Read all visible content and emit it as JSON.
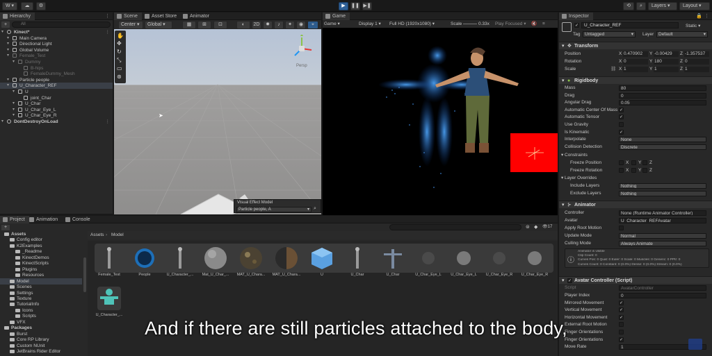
{
  "toolbar": {
    "account_label": "W ▾",
    "layers_label": "Layers",
    "layout_label": "Layout"
  },
  "hierarchy": {
    "tab": "Hierarchy",
    "search_placeholder": "All",
    "items": [
      {
        "label": "Kinect*",
        "indent": 0,
        "state": "scene"
      },
      {
        "label": "Main Camera",
        "indent": 1,
        "state": "normal"
      },
      {
        "label": "Directional Light",
        "indent": 1,
        "state": "normal"
      },
      {
        "label": "Global Volume",
        "indent": 1,
        "state": "normal"
      },
      {
        "label": "Female_Test",
        "indent": 1,
        "state": "dim"
      },
      {
        "label": "Dummy",
        "indent": 2,
        "state": "dim"
      },
      {
        "label": "B-hips",
        "indent": 3,
        "state": "dim"
      },
      {
        "label": "FemaleDummy_Mesh",
        "indent": 3,
        "state": "dim"
      },
      {
        "label": "Particle people",
        "indent": 1,
        "state": "normal"
      },
      {
        "label": "U_Character_REF",
        "indent": 1,
        "state": "selected"
      },
      {
        "label": "U",
        "indent": 2,
        "state": "normal"
      },
      {
        "label": "joint_Char",
        "indent": 3,
        "state": "normal"
      },
      {
        "label": "U_Char",
        "indent": 2,
        "state": "normal"
      },
      {
        "label": "U_Char_Eye_L",
        "indent": 2,
        "state": "normal"
      },
      {
        "label": "U_Char_Eye_R",
        "indent": 2,
        "state": "normal"
      },
      {
        "label": "DontDestroyOnLoad",
        "indent": 0,
        "state": "scene"
      }
    ]
  },
  "scene": {
    "tabs": [
      "Scene",
      "Asset Store",
      "Animator"
    ],
    "pivot": "Center",
    "space": "Global",
    "mode_2d": "2D",
    "persp_label": "Persp",
    "vfx_title": "Visual Effect Model",
    "vfx_value": "Particle people, A"
  },
  "game": {
    "tab": "Game",
    "mode": "Game",
    "display": "Display 1",
    "resolution": "Full HD (1920x1080)",
    "scale_label": "Scale",
    "scale_value": "0.33x",
    "play_focused": "Play Focused"
  },
  "inspector": {
    "tab": "Inspector",
    "object_name": "U_Character_REF",
    "static_label": "Static",
    "tag_label": "Tag",
    "tag_value": "Untagged",
    "layer_label": "Layer",
    "layer_value": "Default",
    "transform": {
      "title": "Transform",
      "position_label": "Position",
      "position": {
        "x": "0.470902",
        "y": "-0.00429",
        "z": "-1.357537"
      },
      "rotation_label": "Rotation",
      "rotation": {
        "x": "0",
        "y": "180",
        "z": "0"
      },
      "scale_label": "Scale",
      "scale": {
        "x": "1",
        "y": "1",
        "z": "1"
      }
    },
    "rigidbody": {
      "title": "Rigidbody",
      "rows": [
        {
          "label": "Mass",
          "value": "80",
          "kind": "field"
        },
        {
          "label": "Drag",
          "value": "0",
          "kind": "field"
        },
        {
          "label": "Angular Drag",
          "value": "0.05",
          "kind": "field"
        },
        {
          "label": "Automatic Center Of Mass",
          "value": "✓",
          "kind": "check"
        },
        {
          "label": "Automatic Tensor",
          "value": "✓",
          "kind": "check"
        },
        {
          "label": "Use Gravity",
          "value": "",
          "kind": "check"
        },
        {
          "label": "Is Kinematic",
          "value": "✓",
          "kind": "check"
        },
        {
          "label": "Interpolate",
          "value": "None",
          "kind": "field"
        },
        {
          "label": "Collision Detection",
          "value": "Discrete",
          "kind": "field"
        }
      ],
      "constraints": "Constraints",
      "freeze_position": "Freeze Position",
      "freeze_rotation": "Freeze Rotation",
      "layer_overrides": "Layer Overrides",
      "include_layers": "Include Layers",
      "include_value": "Nothing",
      "exclude_layers": "Exclude Layers",
      "exclude_value": "Nothing"
    },
    "animator": {
      "title": "Animator",
      "controller_label": "Controller",
      "controller_value": "None (Runtime Animator Controller)",
      "avatar_label": "Avatar",
      "avatar_value": "U_Character_REFAvatar",
      "root_motion_label": "Apply Root Motion",
      "update_mode_label": "Update Mode",
      "update_mode_value": "Normal",
      "culling_mode_label": "Culling Mode",
      "culling_mode_value": "Always Animate",
      "info_lines": [
        "Animator is visible",
        "Clip Count: 0",
        "Curves Pos: 0 Quat: 0 Euler: 0 Scale: 0 Muscles: 0 Generic: 0 PPtr: 0",
        "Curves Count: 0 Constant: 0 (0.0%) Dense: 0 (0.0%) Stream: 0 (0.0%)"
      ]
    },
    "avatar_controller": {
      "title": "Avatar Controller (Script)",
      "script_label": "Script",
      "script_value": "AvatarController",
      "rows": [
        {
          "label": "Player Index",
          "value": "0",
          "kind": "field"
        },
        {
          "label": "Mirrored Movement",
          "value": "✓",
          "kind": "check"
        },
        {
          "label": "Vertical Movement",
          "value": "✓",
          "kind": "check"
        },
        {
          "label": "Horizontal Movement",
          "value": "✓",
          "kind": "check"
        },
        {
          "label": "External Root Motion",
          "value": "",
          "kind": "check"
        },
        {
          "label": "Finger Orientations",
          "value": "",
          "kind": "check"
        },
        {
          "label": "Finger Orientations",
          "value": "✓",
          "kind": "check"
        },
        {
          "label": "Move Rate",
          "value": "1",
          "kind": "field"
        }
      ]
    }
  },
  "project": {
    "tabs": [
      "Project",
      "Animation",
      "Console"
    ],
    "breadcrumb": [
      "Assets",
      "Model"
    ],
    "count": "17",
    "tree": [
      {
        "label": "Assets",
        "indent": 0,
        "bold": true
      },
      {
        "label": "Config editor",
        "indent": 1
      },
      {
        "label": "K2Examples",
        "indent": 1
      },
      {
        "label": "_Readme",
        "indent": 2
      },
      {
        "label": "KinectDemos",
        "indent": 2
      },
      {
        "label": "KinectScripts",
        "indent": 2
      },
      {
        "label": "Plugins",
        "indent": 2
      },
      {
        "label": "Resources",
        "indent": 2
      },
      {
        "label": "Model",
        "indent": 1,
        "selected": true
      },
      {
        "label": "Scenes",
        "indent": 1
      },
      {
        "label": "Settings",
        "indent": 1
      },
      {
        "label": "Texture",
        "indent": 1
      },
      {
        "label": "TutorialInfo",
        "indent": 1
      },
      {
        "label": "Icons",
        "indent": 2
      },
      {
        "label": "Scripts",
        "indent": 2
      },
      {
        "label": "VFX",
        "indent": 1
      },
      {
        "label": "Packages",
        "indent": 0,
        "bold": true
      },
      {
        "label": "Burst",
        "indent": 1
      },
      {
        "label": "Core RP Library",
        "indent": 1
      },
      {
        "label": "Custom NUnit",
        "indent": 1
      },
      {
        "label": "JetBrains Rider Editor",
        "indent": 1
      }
    ],
    "assets": [
      {
        "label": "Female_Test",
        "kind": "figure"
      },
      {
        "label": "People",
        "kind": "vfx"
      },
      {
        "label": "U_Character_...",
        "kind": "figure"
      },
      {
        "label": "Mat_U_Char_...",
        "kind": "mat-gray"
      },
      {
        "label": "MAT_U_Chara...",
        "kind": "mat-tex"
      },
      {
        "label": "MAT_U_Chara...",
        "kind": "mat-dark"
      },
      {
        "label": "U",
        "kind": "prefab"
      },
      {
        "label": "U_Char",
        "kind": "figure"
      },
      {
        "label": "U_Char",
        "kind": "figure-t"
      },
      {
        "label": "U_Char_Eye_L",
        "kind": "ball-dark"
      },
      {
        "label": "U_Char_Eye_L",
        "kind": "ball"
      },
      {
        "label": "U_Char_Eye_R",
        "kind": "ball-dark"
      },
      {
        "label": "U_Char_Eye_R",
        "kind": "ball"
      },
      {
        "label": "U_Character_...",
        "kind": "avatar"
      }
    ]
  },
  "caption": "And if there are still particles attached to the body,",
  "colors": {
    "accent": "#2d5b8c",
    "play_blue": "#2e5f95",
    "selection": "#3a3f47",
    "game_red": "#ff0000"
  }
}
